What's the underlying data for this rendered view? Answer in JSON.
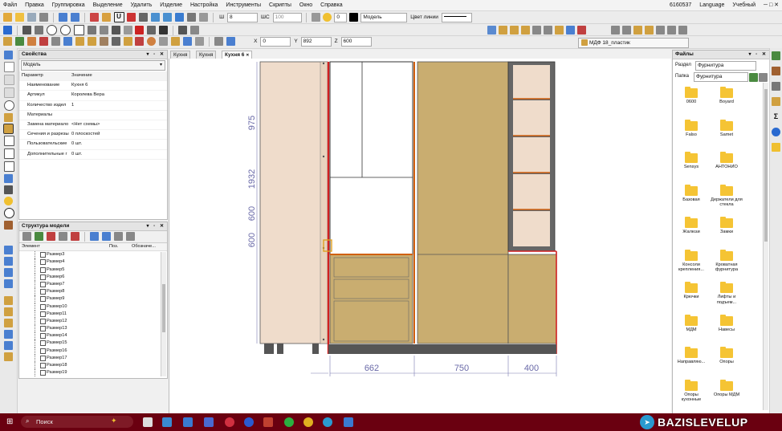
{
  "menu": {
    "items": [
      "Файл",
      "Правка",
      "Группировка",
      "Выделение",
      "Удалить",
      "Изделие",
      "Настройка",
      "Инструменты",
      "Скрипты",
      "Окно",
      "Справка"
    ],
    "right_id": "6160537",
    "language": "Language",
    "mode": "Учебный"
  },
  "toolbar1": {
    "thickness_label": "Ш",
    "thickness_value": "8",
    "ws_label": "ШС",
    "ws_value": "100",
    "layer_value": "0",
    "model_select": "Модель",
    "line_color_label": "Цвет линии"
  },
  "toolbar2": {
    "x_label": "X",
    "x_value": "0",
    "y_label": "Y",
    "y_value": "892",
    "z_label": "Z",
    "z_value": "600"
  },
  "material_bar": {
    "label": "МДФ 18_пластик"
  },
  "properties": {
    "title": "Свойства",
    "selector": "Модель",
    "headers": [
      "Параметр",
      "Значение"
    ],
    "rows": [
      [
        "Наименование",
        "Кухня 6"
      ],
      [
        "Артикул",
        "Королева Вера"
      ],
      [
        "Количество издел",
        "1"
      ],
      [
        "Материалы",
        ""
      ],
      [
        "Замена материало",
        "<Нет схемы>"
      ],
      [
        "Сечения и разрезы",
        "0 плоскостей"
      ],
      [
        "Пользовательские",
        "0 шт."
      ],
      [
        "Дополнительные г",
        "0 шт."
      ]
    ]
  },
  "model_tree": {
    "title": "Структура модели",
    "headers": [
      "Элемент",
      "Поз.",
      "Обозначе..."
    ],
    "items": [
      "Размер3",
      "Размер4",
      "Размер5",
      "Размер6",
      "Размер7",
      "Размер8",
      "Размер9",
      "Размер10",
      "Размер11",
      "Размер12",
      "Размер13",
      "Размер14",
      "Размер15",
      "Размер16",
      "Размер17",
      "Размер18",
      "Размер19"
    ]
  },
  "tabs": [
    "Кухня",
    "Кухня",
    "Кухня 6"
  ],
  "drawing": {
    "vertical_dims": [
      "975",
      "1932",
      "600",
      "600"
    ],
    "horizontal_dims": [
      "662",
      "750",
      "400"
    ]
  },
  "files": {
    "title": "Файлы",
    "section_label": "Раздел",
    "section_value": "Фурнитура",
    "folder_label": "Папка",
    "folder_value": "Фурнитура",
    "folders": [
      "0600",
      "Boyard",
      "Falso",
      "Samet",
      "Sensys",
      "АНТОНИО",
      "Базовая",
      "Держатели для стекла",
      "Жалюзи",
      "Замки",
      "Консоли крепления...",
      "Кроватная фурнитура",
      "Крючки",
      "Лифты и подъем...",
      "МДМ",
      "Навесы",
      "Направляю...",
      "Опоры",
      "Опоры кухонные",
      "Опоры МДМ"
    ]
  },
  "taskbar": {
    "search": "Поиск"
  },
  "watermark": "BAZISLEVELUP"
}
